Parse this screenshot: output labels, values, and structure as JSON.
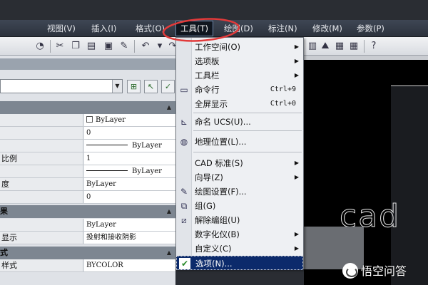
{
  "menubar": {
    "items": [
      "视图(V)",
      "插入(I)",
      "格式(O)",
      "工具(T)",
      "绘图(D)",
      "标注(N)",
      "修改(M)",
      "参数(P)"
    ]
  },
  "toolbar": {
    "icons": [
      "match-properties-icon",
      "cut-icon",
      "copy-icon",
      "paste-icon",
      "paste-block-icon",
      "undo-icon",
      "redo-icon",
      "help-icon"
    ]
  },
  "properties": {
    "rows": [
      {
        "label": "",
        "value": "ByLayer",
        "kind": "checkbox"
      },
      {
        "label": "",
        "value": "0",
        "kind": "text"
      },
      {
        "label": "",
        "value": "ByLayer",
        "kind": "line"
      },
      {
        "label": "比例",
        "value": "1",
        "kind": "text"
      },
      {
        "label": "",
        "value": "ByLayer",
        "kind": "line"
      },
      {
        "label": "度",
        "value": "ByLayer",
        "kind": "text"
      },
      {
        "label": "",
        "value": "0",
        "kind": "text"
      }
    ],
    "section2_header": "果",
    "rows2": [
      {
        "label": "",
        "value": "ByLayer"
      },
      {
        "label": "显示",
        "value": "投射和接收阴影"
      }
    ],
    "section3_header": "式",
    "rows3": [
      {
        "label": "样式",
        "value": "BYCOLOR"
      }
    ]
  },
  "tools_menu": {
    "items": [
      {
        "label": "工作空间(O)",
        "submenu": true,
        "icon": "",
        "shortcut": ""
      },
      {
        "label": "选项板",
        "submenu": true,
        "icon": "",
        "shortcut": ""
      },
      {
        "label": "工具栏",
        "submenu": true,
        "icon": "",
        "shortcut": ""
      },
      {
        "label": "命令行",
        "submenu": false,
        "icon": "command-line-icon",
        "shortcut": "Ctrl+9"
      },
      {
        "label": "全屏显示",
        "submenu": false,
        "icon": "",
        "shortcut": "Ctrl+0"
      },
      {
        "label": "命名 UCS(U)...",
        "submenu": false,
        "icon": "named-ucs-icon",
        "shortcut": ""
      },
      {
        "label": "地理位置(L)...",
        "submenu": false,
        "icon": "geographic-location-icon",
        "shortcut": ""
      },
      {
        "label": "CAD 标准(S)",
        "submenu": true,
        "icon": "",
        "shortcut": ""
      },
      {
        "label": "向导(Z)",
        "submenu": true,
        "icon": "",
        "shortcut": ""
      },
      {
        "label": "绘图设置(F)...",
        "submenu": false,
        "icon": "drafting-settings-icon",
        "shortcut": ""
      },
      {
        "label": "组(G)",
        "submenu": false,
        "icon": "group-icon",
        "shortcut": ""
      },
      {
        "label": "解除编组(U)",
        "submenu": false,
        "icon": "ungroup-icon",
        "shortcut": ""
      },
      {
        "label": "数字化仪(B)",
        "submenu": true,
        "icon": "",
        "shortcut": ""
      },
      {
        "label": "自定义(C)",
        "submenu": true,
        "icon": "",
        "shortcut": ""
      },
      {
        "label": "选项(N)...",
        "submenu": false,
        "icon": "options-icon",
        "shortcut": "",
        "selected": true
      }
    ]
  },
  "drawing": {
    "text": "cad"
  },
  "watermark": {
    "text": "悟空问答"
  }
}
